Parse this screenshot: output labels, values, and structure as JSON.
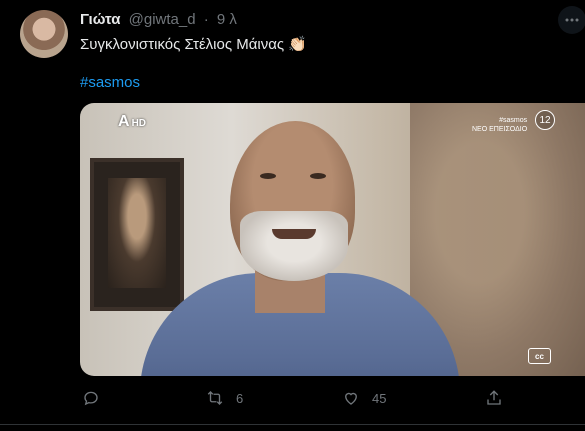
{
  "tweet": {
    "display_name": "Γιώτα",
    "handle": "@giwta_d",
    "separator": "·",
    "time": "9 λ",
    "text": "Συγκλονιστικός Στέλιος Μάινας",
    "emoji": "👏🏻",
    "hashtag": "#sasmos"
  },
  "media": {
    "channel_logo": "A",
    "channel_hd": "HD",
    "overlay_line1": "#sasmos",
    "overlay_line2": "ΝΕΟ ΕΠΕΙΣΟΔΙΟ",
    "rating": "12",
    "cc_label": "cc"
  },
  "actions": {
    "reply_icon": "reply-icon",
    "retweet_count": "6",
    "like_count": "45",
    "share_icon": "share-icon"
  },
  "colors": {
    "background": "#000000",
    "link": "#1d9bf0",
    "secondary_text": "#71767b",
    "primary_text": "#e7e9ea"
  }
}
